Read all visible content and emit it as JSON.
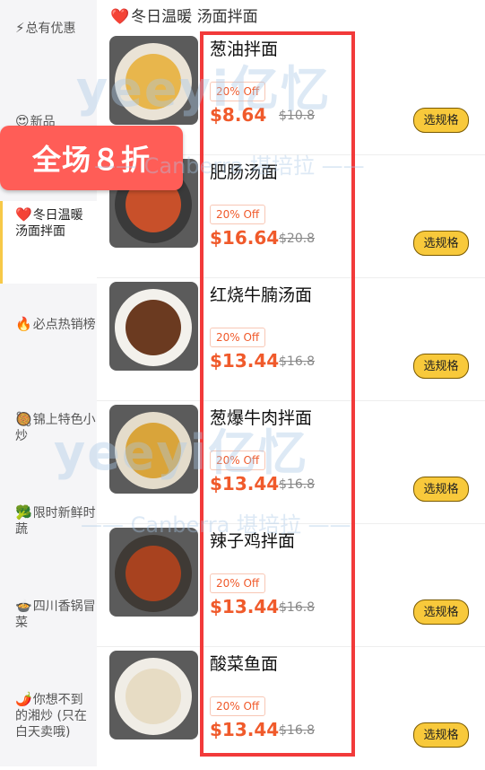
{
  "sidebar": {
    "categories": [
      {
        "emoji": "⚡",
        "label": "总有优惠"
      },
      {
        "emoji": "😍",
        "label": "新品"
      },
      {
        "emoji": "❤️",
        "label": "冬日温暖 汤面拌面"
      },
      {
        "emoji": "🔥",
        "label": "必点热销榜"
      },
      {
        "emoji": "🥘",
        "label": "锦上特色小炒"
      },
      {
        "emoji": "🥦",
        "label": "限时新鲜时蔬"
      },
      {
        "emoji": "🍲",
        "label": "四川香锅冒菜"
      },
      {
        "emoji": "🌶️",
        "label": "你想不到的湘炒 (只在白天卖哦)"
      }
    ]
  },
  "section": {
    "heart": "❤️",
    "title": "冬日温暖 汤面拌面"
  },
  "ribbon": {
    "text": "全场８折"
  },
  "watermark": {
    "brand": "yeeyi亿忆",
    "sub": "—— Canberra 堪培拉 ——"
  },
  "items": [
    {
      "name": "葱油拌面",
      "badge": "20% Off",
      "price": "$8.64",
      "original": "$10.8",
      "button": "选规格"
    },
    {
      "name": "肥肠汤面",
      "badge": "20% Off",
      "price": "$16.64",
      "original": "$20.8",
      "button": "选规格"
    },
    {
      "name": "红烧牛腩汤面",
      "badge": "20% Off",
      "price": "$13.44",
      "original": "$16.8",
      "button": "选规格"
    },
    {
      "name": "葱爆牛肉拌面",
      "badge": "20% Off",
      "price": "$13.44",
      "original": "$16.8",
      "button": "选规格"
    },
    {
      "name": "辣子鸡拌面",
      "badge": "20% Off",
      "price": "$13.44",
      "original": "$16.8",
      "button": "选规格"
    },
    {
      "name": "酸菜鱼面",
      "badge": "20% Off",
      "price": "$13.44",
      "original": "$16.8",
      "button": "选规格"
    }
  ]
}
